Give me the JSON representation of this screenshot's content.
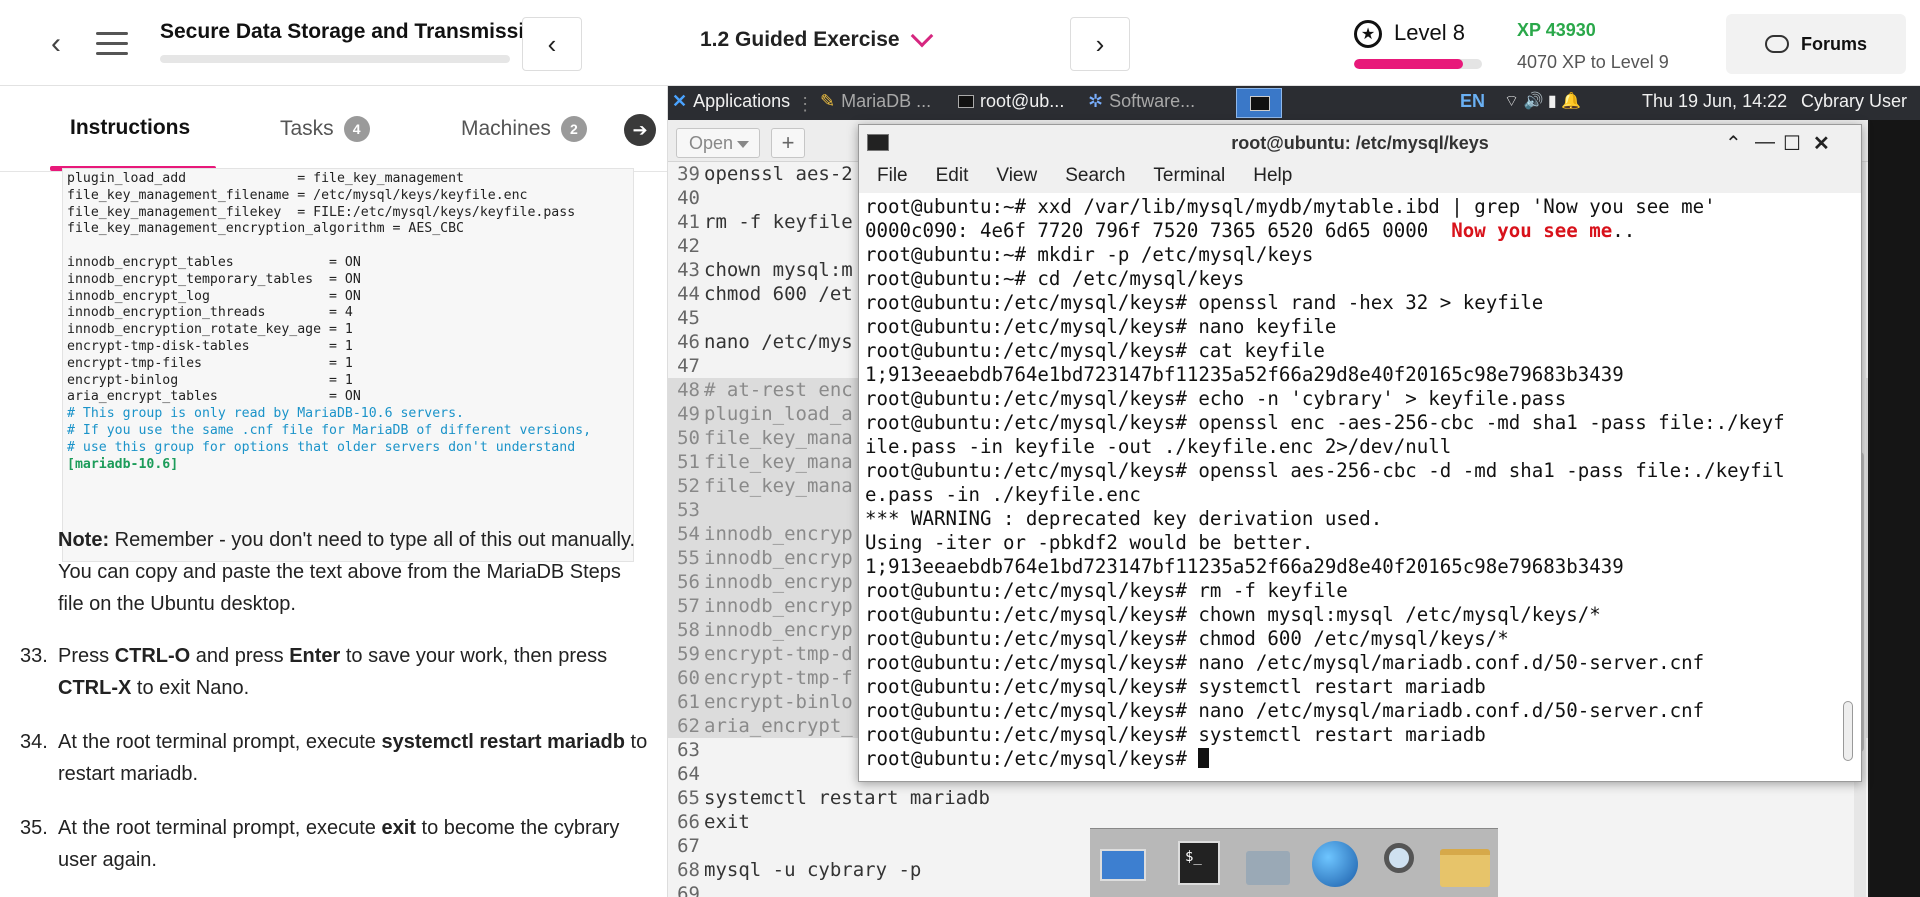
{
  "header": {
    "course_title": "Secure Data Storage and Transmission",
    "lesson_label": "1.2 Guided Exercise",
    "prev_glyph": "‹",
    "next_glyph": "›",
    "back_glyph": "‹",
    "level_label": "Level 8",
    "level_icon_glyph": "★",
    "level_progress": 0.85,
    "xp_label": "XP 43930",
    "xp_to_level": "4070 XP to Level 9",
    "forums_label": "Forums",
    "accent_color": "#e8197a",
    "xp_color": "#2aa84a"
  },
  "tabs": {
    "instructions": "Instructions",
    "tasks": "Tasks",
    "tasks_count": "4",
    "machines": "Machines",
    "machines_count": "2",
    "arrow_glyph": "➔"
  },
  "code_block": [
    {
      "text": "plugin_load_add              = file_key_management",
      "kind": "plain"
    },
    {
      "text": "file_key_management_filename = /etc/mysql/keys/keyfile.enc",
      "kind": "plain"
    },
    {
      "text": "file_key_management_filekey  = FILE:/etc/mysql/keys/keyfile.pass",
      "kind": "plain"
    },
    {
      "text": "file_key_management_encryption_algorithm = AES_CBC",
      "kind": "plain"
    },
    {
      "text": "",
      "kind": "plain"
    },
    {
      "text": "innodb_encrypt_tables            = ON",
      "kind": "plain"
    },
    {
      "text": "innodb_encrypt_temporary_tables  = ON",
      "kind": "plain"
    },
    {
      "text": "innodb_encrypt_log               = ON",
      "kind": "plain"
    },
    {
      "text": "innodb_encryption_threads        = 4",
      "kind": "plain"
    },
    {
      "text": "innodb_encryption_rotate_key_age = 1",
      "kind": "plain"
    },
    {
      "text": "encrypt-tmp-disk-tables          = 1",
      "kind": "plain"
    },
    {
      "text": "encrypt-tmp-files                = 1",
      "kind": "plain"
    },
    {
      "text": "encrypt-binlog                   = 1",
      "kind": "plain"
    },
    {
      "text": "aria_encrypt_tables              = ON",
      "kind": "plain"
    },
    {
      "text": "# This group is only read by MariaDB-10.6 servers.",
      "kind": "comment"
    },
    {
      "text": "# If you use the same .cnf file for MariaDB of different versions,",
      "kind": "comment"
    },
    {
      "text": "# use this group for options that older servers don't understand",
      "kind": "comment"
    },
    {
      "text": "[mariadb-10.6]",
      "kind": "section"
    }
  ],
  "note": {
    "label": "Note:",
    "text": " Remember - you don't need to type all of this out manually. You can copy and paste the text above from the MariaDB Steps file on the Ubuntu desktop."
  },
  "steps": [
    {
      "num": "33.",
      "parts": [
        "Press ",
        "CTRL-O",
        " and press ",
        "Enter",
        " to save your work, then press ",
        "CTRL-X",
        " to exit Nano."
      ]
    },
    {
      "num": "34.",
      "parts": [
        "At the root terminal prompt, execute ",
        "systemctl restart mariadb",
        " to restart mariadb."
      ]
    },
    {
      "num": "35.",
      "parts": [
        "At the root terminal prompt, execute ",
        "exit",
        " to become the cybrary user again."
      ]
    }
  ],
  "taskbar": {
    "apps": "Applications",
    "mariadb": "MariaDB ...",
    "root": "root@ub...",
    "software": "Software...",
    "lang": "EN",
    "tray": "⌔  🔊  ▮  🔔",
    "clock": "Thu 19 Jun, 14:22",
    "user": "Cybrary User"
  },
  "editor": {
    "open_label": "Open",
    "plus_label": "+",
    "lines": [
      {
        "n": "39",
        "t": "openssl aes-2",
        "hl": false
      },
      {
        "n": "40",
        "t": "",
        "hl": false
      },
      {
        "n": "41",
        "t": "rm -f keyfile",
        "hl": false
      },
      {
        "n": "42",
        "t": "",
        "hl": false
      },
      {
        "n": "43",
        "t": "chown mysql:m",
        "hl": false
      },
      {
        "n": "44",
        "t": "chmod 600 /et",
        "hl": false
      },
      {
        "n": "45",
        "t": "",
        "hl": false
      },
      {
        "n": "46",
        "t": "nano /etc/mys",
        "hl": false
      },
      {
        "n": "47",
        "t": "",
        "hl": false
      },
      {
        "n": "48",
        "t": "# at-rest enc",
        "hl": true
      },
      {
        "n": "49",
        "t": "plugin_load_a",
        "hl": true
      },
      {
        "n": "50",
        "t": "file_key_mana",
        "hl": true
      },
      {
        "n": "51",
        "t": "file_key_mana",
        "hl": true
      },
      {
        "n": "52",
        "t": "file_key_mana",
        "hl": true
      },
      {
        "n": "53",
        "t": "",
        "hl": true
      },
      {
        "n": "54",
        "t": "innodb_encryp",
        "hl": true
      },
      {
        "n": "55",
        "t": "innodb_encryp",
        "hl": true
      },
      {
        "n": "56",
        "t": "innodb_encryp",
        "hl": true
      },
      {
        "n": "57",
        "t": "innodb_encryp",
        "hl": true
      },
      {
        "n": "58",
        "t": "innodb_encryp",
        "hl": true
      },
      {
        "n": "59",
        "t": "encrypt-tmp-d",
        "hl": true
      },
      {
        "n": "60",
        "t": "encrypt-tmp-f",
        "hl": true
      },
      {
        "n": "61",
        "t": "encrypt-binlo",
        "hl": true
      },
      {
        "n": "62",
        "t": "aria_encrypt_",
        "hl": true
      },
      {
        "n": "63",
        "t": "",
        "hl": false
      },
      {
        "n": "64",
        "t": "",
        "hl": false
      },
      {
        "n": "65",
        "t": "systemctl restart mariadb",
        "hl": false
      },
      {
        "n": "66",
        "t": "exit",
        "hl": false
      },
      {
        "n": "67",
        "t": "",
        "hl": false
      },
      {
        "n": "68",
        "t": "mysql -u cybrary -p",
        "hl": false
      },
      {
        "n": "69",
        "t": "",
        "hl": false
      }
    ]
  },
  "terminal": {
    "title": "root@ubuntu: /etc/mysql/keys",
    "menu": [
      "File",
      "Edit",
      "View",
      "Search",
      "Terminal",
      "Help"
    ],
    "controls": {
      "up": "⌃",
      "min": "—",
      "max": "☐",
      "close": "✕"
    },
    "lines": [
      {
        "text": "root@ubuntu:~# xxd /var/lib/mysql/mydb/mytable.ibd | grep 'Now you see me'"
      },
      {
        "text": "0000c090: 4e6f 7720 796f 7520 7365 6520 6d65 0000  ",
        "red": "Now you see me",
        "tail": ".."
      },
      {
        "text": "root@ubuntu:~# mkdir -p /etc/mysql/keys"
      },
      {
        "text": "root@ubuntu:~# cd /etc/mysql/keys"
      },
      {
        "text": "root@ubuntu:/etc/mysql/keys# openssl rand -hex 32 > keyfile"
      },
      {
        "text": "root@ubuntu:/etc/mysql/keys# nano keyfile"
      },
      {
        "text": "root@ubuntu:/etc/mysql/keys# cat keyfile"
      },
      {
        "text": "1;913eeaebdb764e1bd723147bf11235a52f66a29d8e40f20165c98e79683b3439"
      },
      {
        "text": "root@ubuntu:/etc/mysql/keys# echo -n 'cybrary' > keyfile.pass"
      },
      {
        "text": "root@ubuntu:/etc/mysql/keys# openssl enc -aes-256-cbc -md sha1 -pass file:./keyf"
      },
      {
        "text": "ile.pass -in keyfile -out ./keyfile.enc 2>/dev/null"
      },
      {
        "text": "root@ubuntu:/etc/mysql/keys# openssl aes-256-cbc -d -md sha1 -pass file:./keyfil"
      },
      {
        "text": "e.pass -in ./keyfile.enc"
      },
      {
        "text": "*** WARNING : deprecated key derivation used."
      },
      {
        "text": "Using -iter or -pbkdf2 would be better."
      },
      {
        "text": "1;913eeaebdb764e1bd723147bf11235a52f66a29d8e40f20165c98e79683b3439"
      },
      {
        "text": "root@ubuntu:/etc/mysql/keys# rm -f keyfile"
      },
      {
        "text": "root@ubuntu:/etc/mysql/keys# chown mysql:mysql /etc/mysql/keys/*"
      },
      {
        "text": "root@ubuntu:/etc/mysql/keys# chmod 600 /etc/mysql/keys/*"
      },
      {
        "text": "root@ubuntu:/etc/mysql/keys# nano /etc/mysql/mariadb.conf.d/50-server.cnf"
      },
      {
        "text": "root@ubuntu:/etc/mysql/keys# systemctl restart mariadb"
      },
      {
        "text": "root@ubuntu:/etc/mysql/keys# nano /etc/mysql/mariadb.conf.d/50-server.cnf"
      },
      {
        "text": "root@ubuntu:/etc/mysql/keys# systemctl restart mariadb"
      },
      {
        "text": "root@ubuntu:/etc/mysql/keys# ",
        "cursor": true
      }
    ]
  },
  "dock": {
    "terminal_glyph": "$_"
  }
}
